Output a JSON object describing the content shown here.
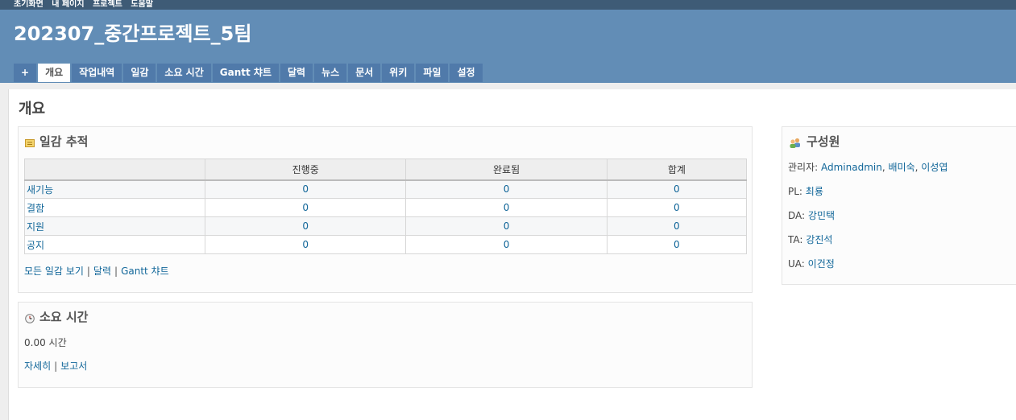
{
  "top_menu": [
    "초기화면",
    "내 페이지",
    "프로젝트",
    "도움말"
  ],
  "project_title": "202307_중간프로젝트_5팀",
  "tabs": [
    "+",
    "개요",
    "작업내역",
    "일감",
    "소요 시간",
    "Gantt 챠트",
    "달력",
    "뉴스",
    "문서",
    "위키",
    "파일",
    "설정"
  ],
  "page_title": "개요",
  "issues": {
    "title": "일감 추적",
    "columns": [
      "",
      "진행중",
      "완료됨",
      "합계"
    ],
    "rows": [
      {
        "tracker": "새기능",
        "open": "0",
        "closed": "0",
        "total": "0"
      },
      {
        "tracker": "결함",
        "open": "0",
        "closed": "0",
        "total": "0"
      },
      {
        "tracker": "지원",
        "open": "0",
        "closed": "0",
        "total": "0"
      },
      {
        "tracker": "공지",
        "open": "0",
        "closed": "0",
        "total": "0"
      }
    ],
    "links": [
      "모든 일감 보기",
      "달력",
      "Gantt 챠트"
    ],
    "separator": "|"
  },
  "spent_time": {
    "title": "소요 시간",
    "value": "0.00 시간",
    "links": [
      "자세히",
      "보고서"
    ]
  },
  "members": {
    "title": "구성원",
    "roles": [
      {
        "role": "관리자:",
        "names": [
          "Adminadmin",
          "배미숙",
          "이성엽"
        ]
      },
      {
        "role": "PL:",
        "names": [
          "최룡"
        ]
      },
      {
        "role": "DA:",
        "names": [
          "강민택"
        ]
      },
      {
        "role": "TA:",
        "names": [
          "강진석"
        ]
      },
      {
        "role": "UA:",
        "names": [
          "이건정"
        ]
      }
    ]
  },
  "colors": {
    "header": "#628db6",
    "top_menu": "#3e5b76",
    "tab": "#507aaa",
    "link": "#116699"
  },
  "icons": {
    "issues": "issues-icon",
    "time": "clock-icon",
    "members": "group-icon"
  }
}
